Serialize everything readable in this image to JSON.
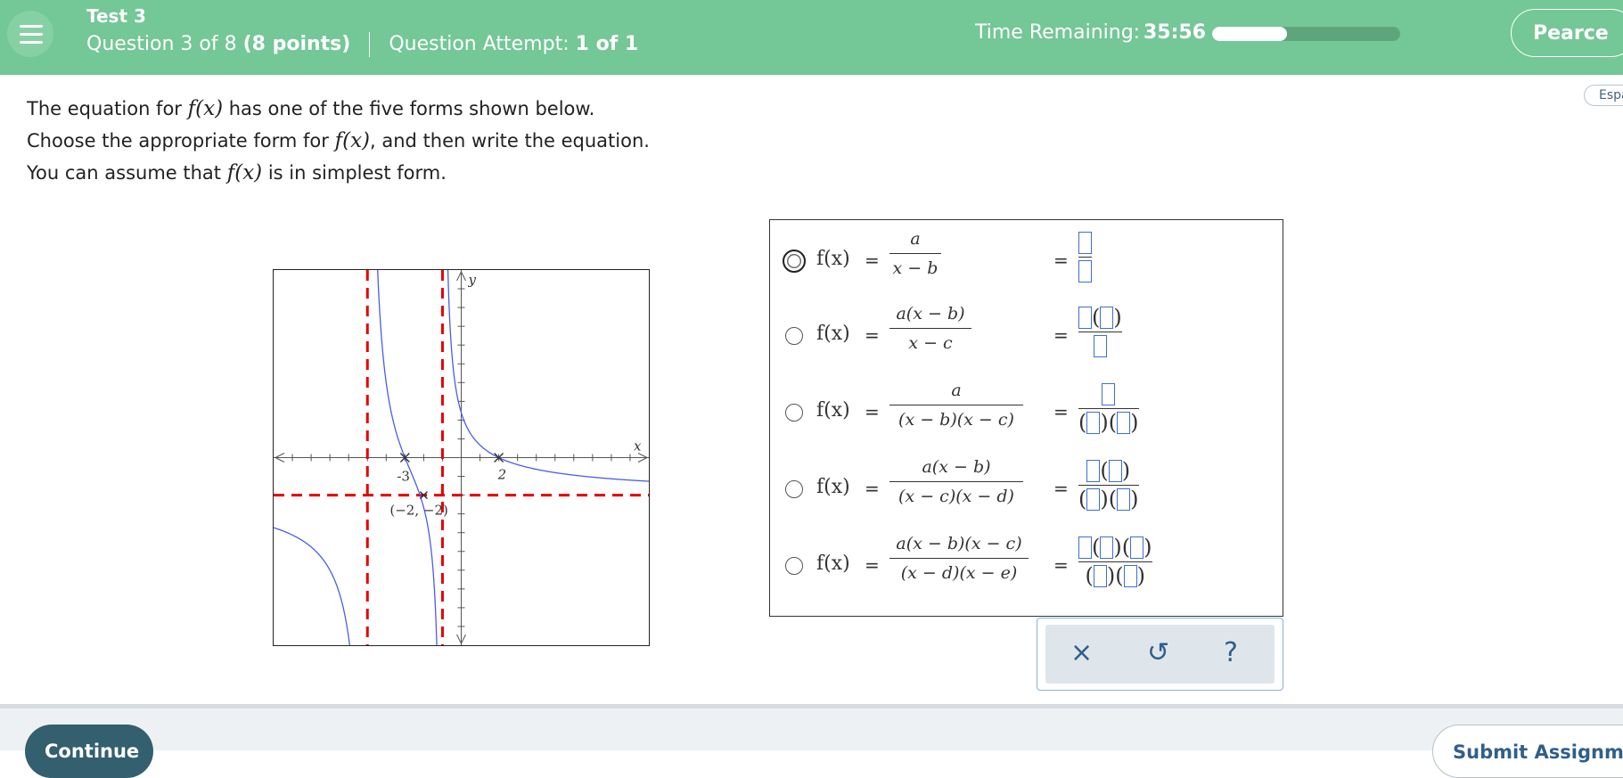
{
  "header": {
    "test_name": "Test 3",
    "question_text": "Question 3 of 8",
    "question_points": "(8 points)",
    "attempt_label": "Question Attempt:",
    "attempt_value": "1 of 1",
    "time_label": "Time Remaining:",
    "time_value": "35:56",
    "time_progress": 0.4,
    "user_name": "Pearce"
  },
  "language_button": "Espa",
  "instructions": {
    "line1_pre": "The equation for",
    "line1_post": "has one of the five forms shown below.",
    "line2_pre": "Choose the appropriate form for",
    "line2_post": ", and then write the equation.",
    "line3_pre": "You can assume that",
    "line3_post": "is in simplest form.",
    "fx": "f(x)"
  },
  "graph": {
    "labels": {
      "y_axis": "y",
      "x_axis": "x",
      "tick_neg3": "-3",
      "tick_2": "2",
      "point": "(−2, −2)"
    },
    "x_range": [
      -10,
      10
    ],
    "y_range": [
      -10,
      10
    ],
    "vertical_asymptotes": [
      -5,
      -1
    ],
    "horizontal_asymptote": -2,
    "x_intercepts": [
      -3,
      2
    ],
    "marked_point": [
      -2,
      -2
    ]
  },
  "options": [
    {
      "f": "f(x)",
      "eq": "=",
      "num": "a",
      "den": "x − b",
      "selected": true
    },
    {
      "f": "f(x)",
      "eq": "=",
      "num": "a(x − b)",
      "den": "x − c",
      "selected": false
    },
    {
      "f": "f(x)",
      "eq": "=",
      "num": "a",
      "den": "(x − b)(x − c)",
      "selected": false
    },
    {
      "f": "f(x)",
      "eq": "=",
      "num": "a(x − b)",
      "den": "(x − c)(x − d)",
      "selected": false
    },
    {
      "f": "f(x)",
      "eq": "=",
      "num": "a(x − b)(x − c)",
      "den": "(x − d)(x − e)",
      "selected": false
    }
  ],
  "tools": {
    "clear_icon": "×",
    "undo_icon": "↺",
    "help_icon": "?"
  },
  "footer": {
    "continue_label": "Continue",
    "submit_label": "Submit Assignment"
  },
  "colors": {
    "header_bg": "#74c796",
    "asymptote": "#e60000",
    "curve": "#4a5de8",
    "slot_border": "#3c6fd4"
  }
}
